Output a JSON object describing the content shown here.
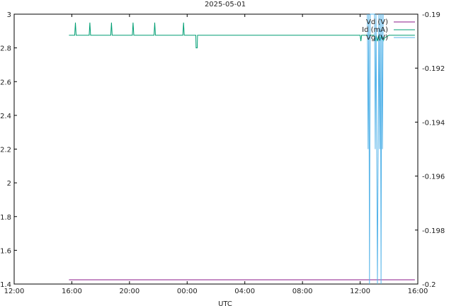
{
  "chart_data": {
    "type": "line",
    "title": "2025-05-01",
    "xlabel": "UTC",
    "ylabel": "",
    "y2label": "",
    "x_ticks": [
      "12:00",
      "16:00",
      "20:00",
      "00:00",
      "04:00",
      "08:00",
      "12:00",
      "16:00"
    ],
    "xlim_hours": [
      0,
      28
    ],
    "ylim": [
      1.4,
      3.0
    ],
    "y_ticks": [
      "1.4",
      "1.6",
      "1.8",
      "2",
      "2.2",
      "2.4",
      "2.6",
      "2.8",
      "3"
    ],
    "y2lim": [
      -0.2,
      -0.19
    ],
    "y2_ticks": [
      "-0.2",
      "-0.198",
      "-0.196",
      "-0.194",
      "-0.192",
      "-0.19"
    ],
    "legend_position": "top-right",
    "series": [
      {
        "name": "Vd (V)",
        "axis": "y",
        "color": "#8b1a89",
        "points": [
          [
            3.8,
            1.425
          ],
          [
            27.8,
            1.425
          ]
        ]
      },
      {
        "name": "Id (mA)",
        "axis": "y",
        "color": "#009e73",
        "points": [
          [
            3.8,
            2.875
          ],
          [
            4.2,
            2.875
          ],
          [
            4.25,
            2.95
          ],
          [
            4.3,
            2.875
          ],
          [
            5.2,
            2.875
          ],
          [
            5.25,
            2.95
          ],
          [
            5.3,
            2.875
          ],
          [
            6.7,
            2.875
          ],
          [
            6.75,
            2.95
          ],
          [
            6.8,
            2.875
          ],
          [
            8.2,
            2.875
          ],
          [
            8.25,
            2.95
          ],
          [
            8.3,
            2.875
          ],
          [
            9.7,
            2.875
          ],
          [
            9.75,
            2.95
          ],
          [
            9.8,
            2.875
          ],
          [
            11.7,
            2.875
          ],
          [
            11.75,
            2.95
          ],
          [
            11.8,
            2.875
          ],
          [
            12.6,
            2.875
          ],
          [
            12.62,
            2.8
          ],
          [
            12.7,
            2.8
          ],
          [
            12.72,
            2.875
          ],
          [
            24.0,
            2.875
          ],
          [
            24.05,
            2.84
          ],
          [
            24.1,
            2.875
          ],
          [
            25.0,
            2.875
          ],
          [
            25.05,
            2.84
          ],
          [
            25.1,
            2.88
          ],
          [
            25.2,
            2.84
          ],
          [
            25.3,
            2.88
          ],
          [
            25.4,
            2.84
          ],
          [
            25.5,
            2.88
          ],
          [
            25.6,
            2.84
          ],
          [
            25.7,
            2.86
          ],
          [
            26.0,
            2.875
          ],
          [
            27.8,
            2.875
          ]
        ]
      },
      {
        "name": "Vg (V)",
        "axis": "y",
        "color": "#56b4e9",
        "points": [
          [
            24.5,
            3.0
          ],
          [
            24.55,
            2.2
          ],
          [
            24.6,
            3.0
          ],
          [
            24.65,
            1.4
          ],
          [
            24.7,
            3.0
          ],
          [
            25.0,
            3.0
          ],
          [
            25.05,
            2.2
          ],
          [
            25.1,
            3.0
          ],
          [
            25.2,
            1.4
          ],
          [
            25.3,
            3.0
          ],
          [
            25.35,
            2.2
          ],
          [
            25.4,
            3.0
          ],
          [
            25.45,
            1.4
          ],
          [
            25.5,
            3.0
          ],
          [
            25.55,
            2.2
          ],
          [
            25.6,
            3.0
          ]
        ]
      }
    ]
  }
}
